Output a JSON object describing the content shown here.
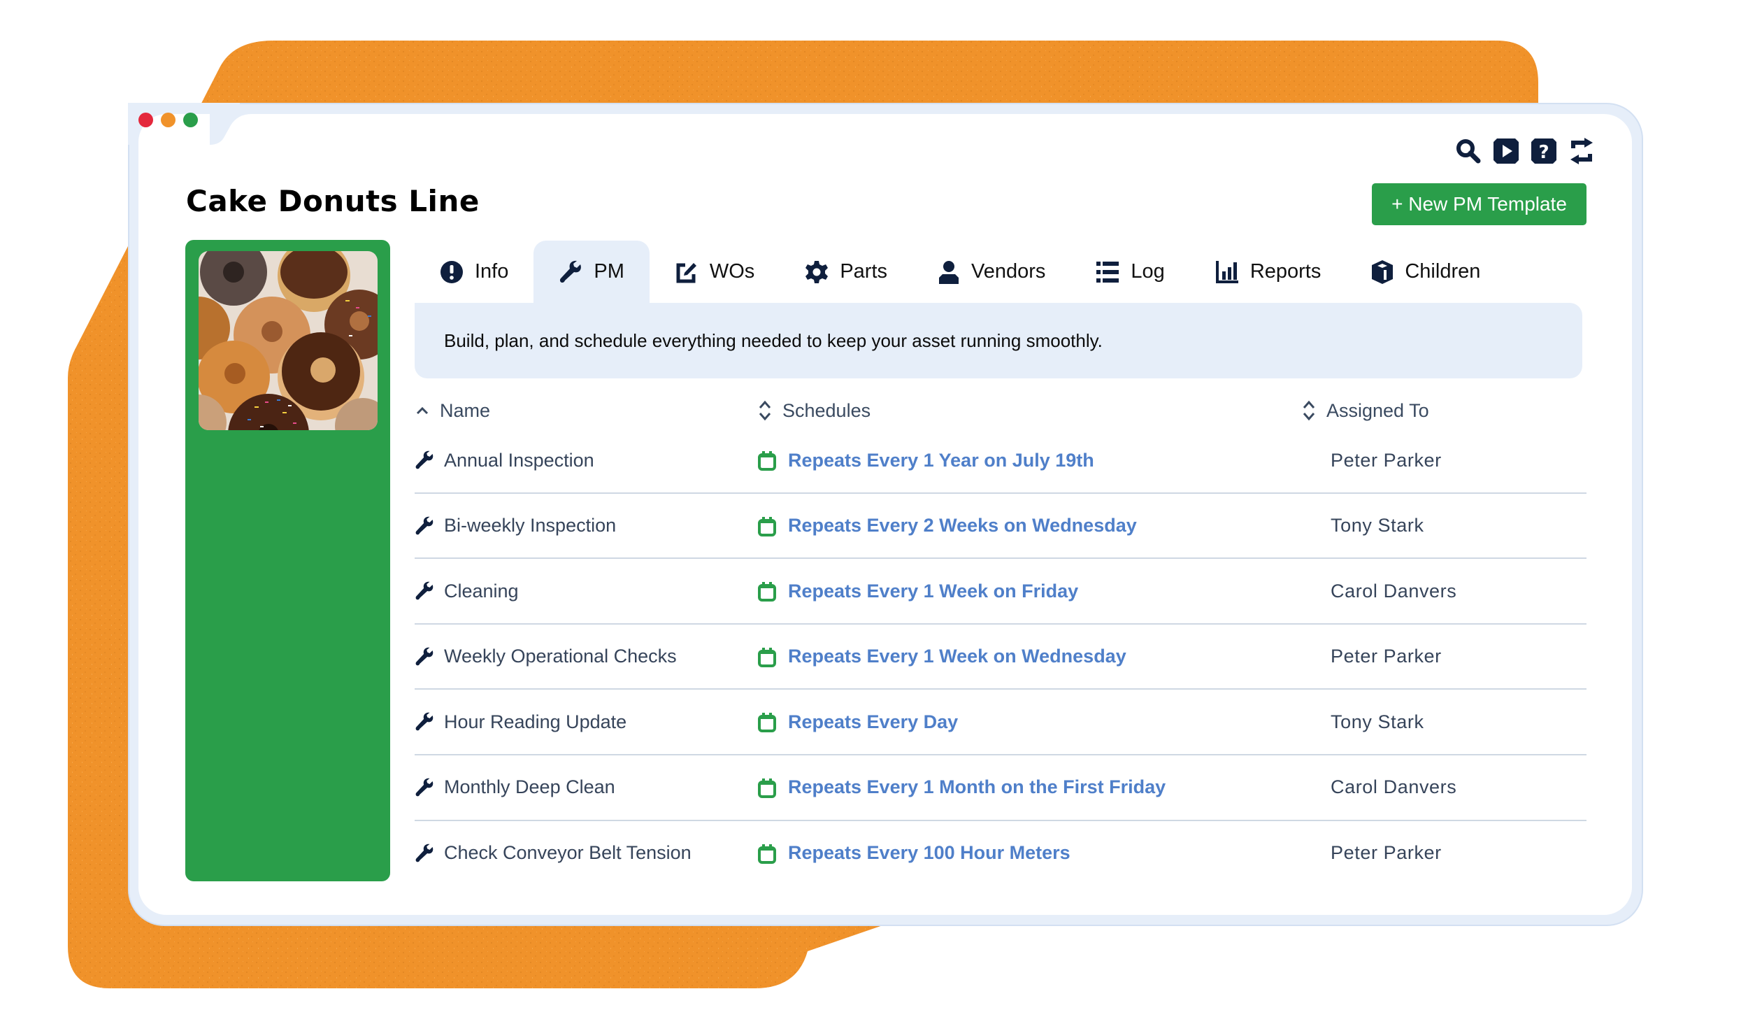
{
  "window": {
    "title": "Cake Donuts Line",
    "traffic_lights": [
      "#e4283c",
      "#f0922a",
      "#2a9e4a"
    ]
  },
  "colors": {
    "accent_green": "#2a9e4a",
    "background_orange": "#f0922a",
    "link_blue": "#4f7fc9",
    "icon_navy": "#0f1f3d",
    "panel_bg": "#e6eef9"
  },
  "toolbar": {
    "icons": [
      "search-icon",
      "play-video-icon",
      "help-icon",
      "refresh-icon"
    ],
    "new_button_label": "+ New PM Template"
  },
  "asset": {
    "image_alt": "Assorted donuts"
  },
  "tabs": [
    {
      "label": "Info",
      "icon": "info-icon",
      "active": false
    },
    {
      "label": "PM",
      "icon": "wrench-icon",
      "active": true
    },
    {
      "label": "WOs",
      "icon": "edit-icon",
      "active": false
    },
    {
      "label": "Parts",
      "icon": "gear-icon",
      "active": false
    },
    {
      "label": "Vendors",
      "icon": "user-icon",
      "active": false
    },
    {
      "label": "Log",
      "icon": "list-icon",
      "active": false
    },
    {
      "label": "Reports",
      "icon": "bar-chart-icon",
      "active": false
    },
    {
      "label": "Children",
      "icon": "cube-icon",
      "active": false
    }
  ],
  "banner": {
    "text": "Build, plan, and schedule everything needed to keep your asset running smoothly."
  },
  "table": {
    "columns": [
      {
        "label": "Name",
        "sort": "ascending"
      },
      {
        "label": "Schedules",
        "sort": "none"
      },
      {
        "label": "Assigned To",
        "sort": "none"
      }
    ],
    "rows": [
      {
        "name": "Annual Inspection",
        "schedule": "Repeats Every 1 Year on July 19th",
        "assigned": "Peter Parker"
      },
      {
        "name": "Bi-weekly Inspection",
        "schedule": "Repeats Every 2 Weeks on Wednesday",
        "assigned": "Tony Stark"
      },
      {
        "name": "Cleaning",
        "schedule": "Repeats Every 1 Week on Friday",
        "assigned": "Carol Danvers"
      },
      {
        "name": "Weekly Operational Checks",
        "schedule": "Repeats Every 1 Week on Wednesday",
        "assigned": "Peter Parker"
      },
      {
        "name": "Hour Reading Update",
        "schedule": "Repeats Every Day",
        "assigned": "Tony Stark"
      },
      {
        "name": "Monthly Deep Clean",
        "schedule": "Repeats Every 1 Month on the First Friday",
        "assigned": "Carol Danvers"
      },
      {
        "name": "Check Conveyor Belt Tension",
        "schedule": "Repeats Every 100 Hour Meters",
        "assigned": "Peter Parker"
      }
    ]
  }
}
